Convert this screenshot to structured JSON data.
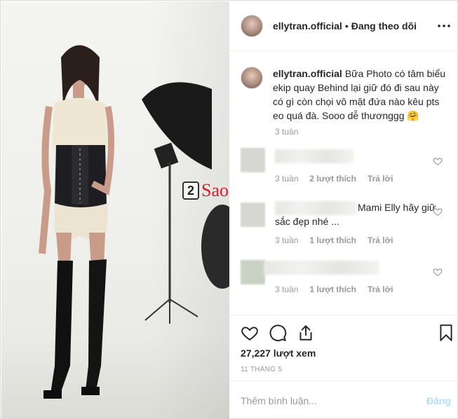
{
  "watermark": {
    "box": "2",
    "text": "Sao"
  },
  "header": {
    "username": "ellytran.official",
    "separator": "•",
    "follow_label": "Đang theo dõi",
    "more_icon": "more-horizontal-icon"
  },
  "caption": {
    "username": "ellytran.official",
    "text": "Bữa Photo có tâm biểu ekip quay Behind lại giữ đó đi sau này có gì còn chọi vô mặt đứa nào kêu pts eo quá đà. Sooo dễ thươnggg 🤗",
    "time": "3 tuần"
  },
  "comments": [
    {
      "text": "",
      "time": "3 tuần",
      "likes": "2 lượt thích",
      "reply": "Trả lời"
    },
    {
      "text": "Mami Elly hãy giữ sắc đẹp nhé ...",
      "time": "3 tuần",
      "likes": "1 lượt thích",
      "reply": "Trả lời"
    },
    {
      "text": "",
      "time": "3 tuần",
      "likes": "1 lượt thích",
      "reply": "Trả lời"
    }
  ],
  "actions": {
    "views_count": "27,227",
    "views_label": "lượt xem",
    "date": "11 THÁNG 5"
  },
  "add_comment": {
    "placeholder": "Thêm bình luận...",
    "post_label": "Đăng"
  },
  "colors": {
    "link": "#b2dffc",
    "muted": "#999999",
    "text": "#262626",
    "watermark_red": "#d71f26"
  }
}
